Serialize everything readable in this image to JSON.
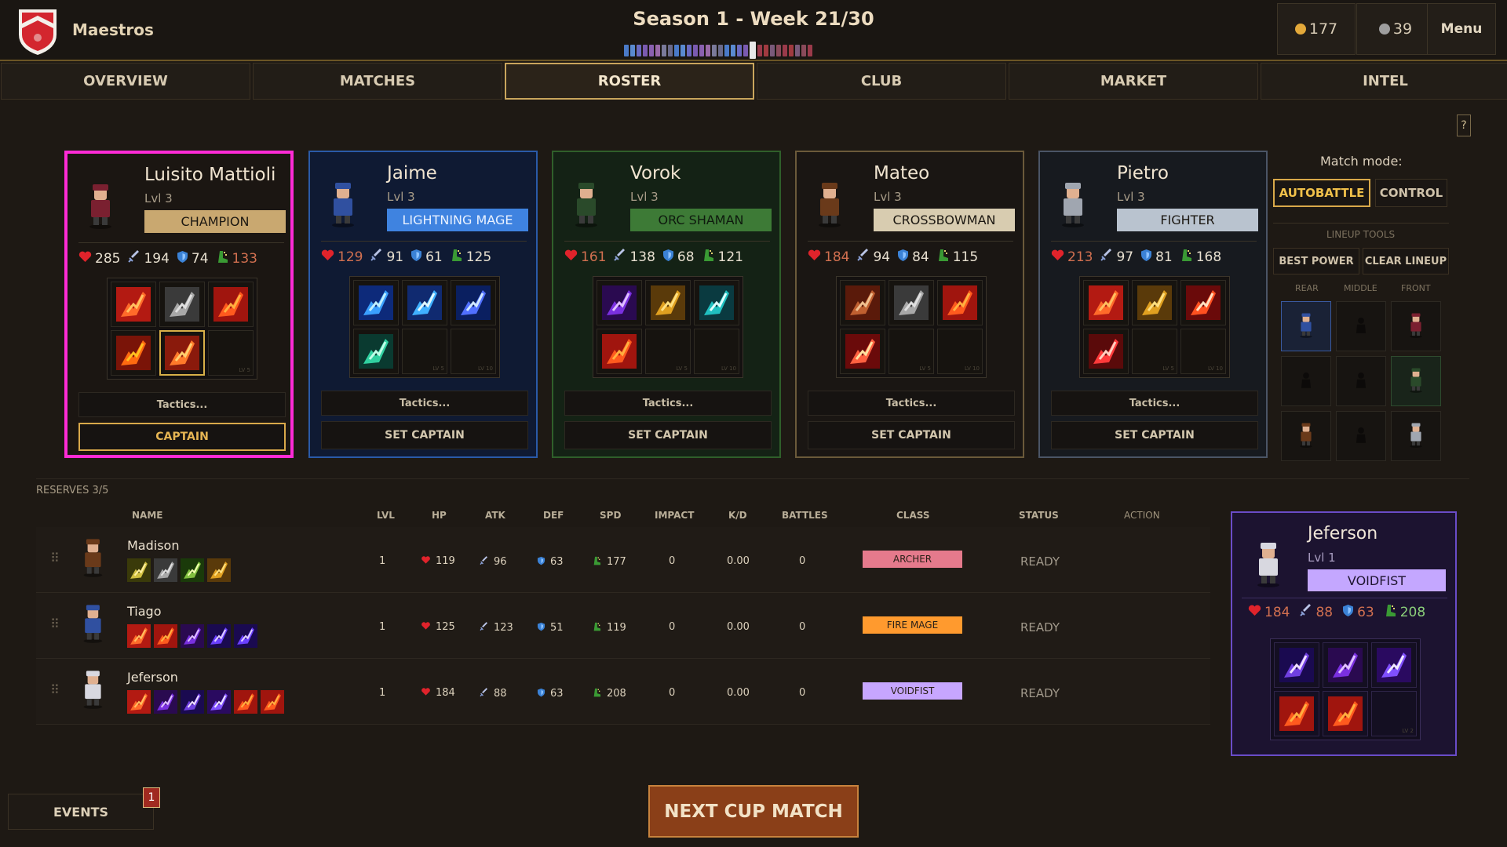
{
  "header": {
    "club_name": "Maestros",
    "season_title": "Season 1 - Week 21/30",
    "week_current": 21,
    "week_total": 30,
    "gold": "177",
    "silver": "39",
    "menu_label": "Menu"
  },
  "tabs": [
    "OVERVIEW",
    "MATCHES",
    "ROSTER",
    "CLUB",
    "MARKET",
    "INTEL"
  ],
  "active_tab": "ROSTER",
  "help_label": "?",
  "lineup": [
    {
      "name": "Luisito Mattioli",
      "level": "Lvl 3",
      "class": "CHAMPION",
      "class_color": "#c9a870",
      "border": "#ff2bd6",
      "bg": "#1b1612",
      "hp": "285",
      "atk": "194",
      "def": "74",
      "spd": "133",
      "highlight_stat": "spd",
      "skills": [
        "flame-sword-icon",
        "stone-fist-icon",
        "fire-burst-icon",
        "crescent-flame-icon",
        "blaze-slash-icon",
        "locked-slot-icon"
      ],
      "skill_active_index": 4,
      "slot_labels": [
        "",
        "",
        "",
        "",
        "",
        "LV 5"
      ],
      "tactics": "Tactics...",
      "action": "CAPTAIN"
    },
    {
      "name": "Jaime",
      "level": "Lvl 3",
      "class": "LIGHTNING MAGE",
      "class_color": "#3f83e0",
      "border": "#2a5aa8",
      "bg": "#0f1a33",
      "hp": "129",
      "atk": "91",
      "def": "61",
      "spd": "125",
      "highlight_stat": "hp",
      "skills": [
        "lightning-bolt-icon",
        "storm-wave-icon",
        "chain-lightning-icon",
        "static-field-icon",
        "locked-slot-icon",
        "locked-slot-icon"
      ],
      "skill_active_index": -1,
      "slot_labels": [
        "",
        "",
        "",
        "",
        "LV 5",
        "LV 10"
      ],
      "tactics": "Tactics...",
      "action": "SET CAPTAIN"
    },
    {
      "name": "Vorok",
      "level": "Lvl 3",
      "class": "ORC SHAMAN",
      "class_color": "#3d7a36",
      "border": "#2f5f2a",
      "bg": "#142215",
      "hp": "161",
      "atk": "138",
      "def": "68",
      "spd": "121",
      "highlight_stat": "hp",
      "skills": [
        "void-vortex-icon",
        "golden-fist-icon",
        "totem-icon",
        "fire-dash-icon",
        "locked-slot-icon",
        "locked-slot-icon"
      ],
      "skill_active_index": -1,
      "slot_labels": [
        "",
        "",
        "",
        "",
        "LV 5",
        "LV 10"
      ],
      "tactics": "Tactics...",
      "action": "SET CAPTAIN"
    },
    {
      "name": "Mateo",
      "level": "Lvl 3",
      "class": "CROSSBOWMAN",
      "class_color": "#d8ccb0",
      "border": "#6b5a3a",
      "bg": "#1a1613",
      "hp": "184",
      "atk": "94",
      "def": "84",
      "spd": "115",
      "highlight_stat": "hp",
      "skills": [
        "crossbow-shot-icon",
        "stone-fist-icon",
        "fireball-icon",
        "explosive-bolt-icon",
        "locked-slot-icon",
        "locked-slot-icon"
      ],
      "skill_active_index": -1,
      "slot_labels": [
        "",
        "",
        "",
        "",
        "LV 5",
        "LV 10"
      ],
      "tactics": "Tactics...",
      "action": "SET CAPTAIN"
    },
    {
      "name": "Pietro",
      "level": "Lvl 3",
      "class": "FIGHTER",
      "class_color": "#b9c3cf",
      "border": "#4b5566",
      "bg": "#171a1f",
      "hp": "213",
      "atk": "97",
      "def": "81",
      "spd": "168",
      "highlight_stat": "hp",
      "skills": [
        "flame-sword-icon",
        "golden-fist-icon",
        "flying-kick-icon",
        "whirl-strike-icon",
        "locked-slot-icon",
        "locked-slot-icon"
      ],
      "skill_active_index": -1,
      "slot_labels": [
        "",
        "",
        "",
        "",
        "LV 5",
        "LV 10"
      ],
      "tactics": "Tactics...",
      "action": "SET CAPTAIN"
    }
  ],
  "side": {
    "match_mode_label": "Match mode:",
    "autobattle": "AUTOBATTLE",
    "control": "CONTROL",
    "lineup_tools": "LINEUP TOOLS",
    "best_power": "BEST POWER",
    "clear_lineup": "CLEAR LINEUP",
    "rear": "REAR",
    "middle": "MIDDLE",
    "front": "FRONT",
    "grid": [
      "mage-figure-icon",
      "empty-slot-icon",
      "champion-figure-icon",
      "empty-slot-icon",
      "empty-slot-icon",
      "orc-figure-icon",
      "crossbowman-figure-icon",
      "empty-slot-icon",
      "knight-figure-icon"
    ]
  },
  "reserves": {
    "label": "RESERVES 3/5",
    "columns": [
      "NAME",
      "LVL",
      "HP",
      "ATK",
      "DEF",
      "SPD",
      "IMPACT",
      "K/D",
      "BATTLES",
      "CLASS",
      "STATUS",
      "ACTION"
    ],
    "rows": [
      {
        "name": "Madison",
        "lvl": "1",
        "hp": "119",
        "atk": "96",
        "def": "63",
        "spd": "177",
        "impact": "0",
        "kd": "0.00",
        "battles": "0",
        "class": "ARCHER",
        "class_color": "#e57a8c",
        "status": "READY",
        "skills": [
          "arrow-volley-icon",
          "stone-fist-icon",
          "vine-arrow-icon",
          "golden-arrow-icon"
        ]
      },
      {
        "name": "Tiago",
        "lvl": "1",
        "hp": "125",
        "atk": "123",
        "def": "51",
        "spd": "119",
        "impact": "0",
        "kd": "0.00",
        "battles": "0",
        "class": "FIRE MAGE",
        "class_color": "#ff9a2e",
        "status": "READY",
        "skills": [
          "flame-burst-icon",
          "fire-storm-icon",
          "void-claw-icon",
          "arcane-figure-icon",
          "arcane-skull-icon"
        ]
      },
      {
        "name": "Jeferson",
        "lvl": "1",
        "hp": "184",
        "atk": "88",
        "def": "63",
        "spd": "208",
        "impact": "0",
        "kd": "0.00",
        "battles": "0",
        "class": "VOIDFIST",
        "class_color": "#c7a6ff",
        "status": "READY",
        "skills": [
          "flame-hand-icon",
          "void-claw-icon",
          "palm-strike-icon",
          "cross-slash-icon",
          "fire-grab-icon",
          "fire-burst-icon"
        ]
      }
    ]
  },
  "preview": {
    "name": "Jeferson",
    "level": "Lvl 1",
    "class": "VOIDFIST",
    "hp": "184",
    "atk": "88",
    "def": "63",
    "spd": "208",
    "skills": [
      "palm-strike-icon",
      "void-claw-icon",
      "cross-slash-icon",
      "fire-grab-icon",
      "fire-fist-icon",
      "locked-slot-icon"
    ],
    "slot_labels": [
      "",
      "",
      "",
      "",
      "",
      "LV 2"
    ]
  },
  "next_match": "NEXT CUP MATCH",
  "events": {
    "label": "EVENTS",
    "count": "1"
  }
}
